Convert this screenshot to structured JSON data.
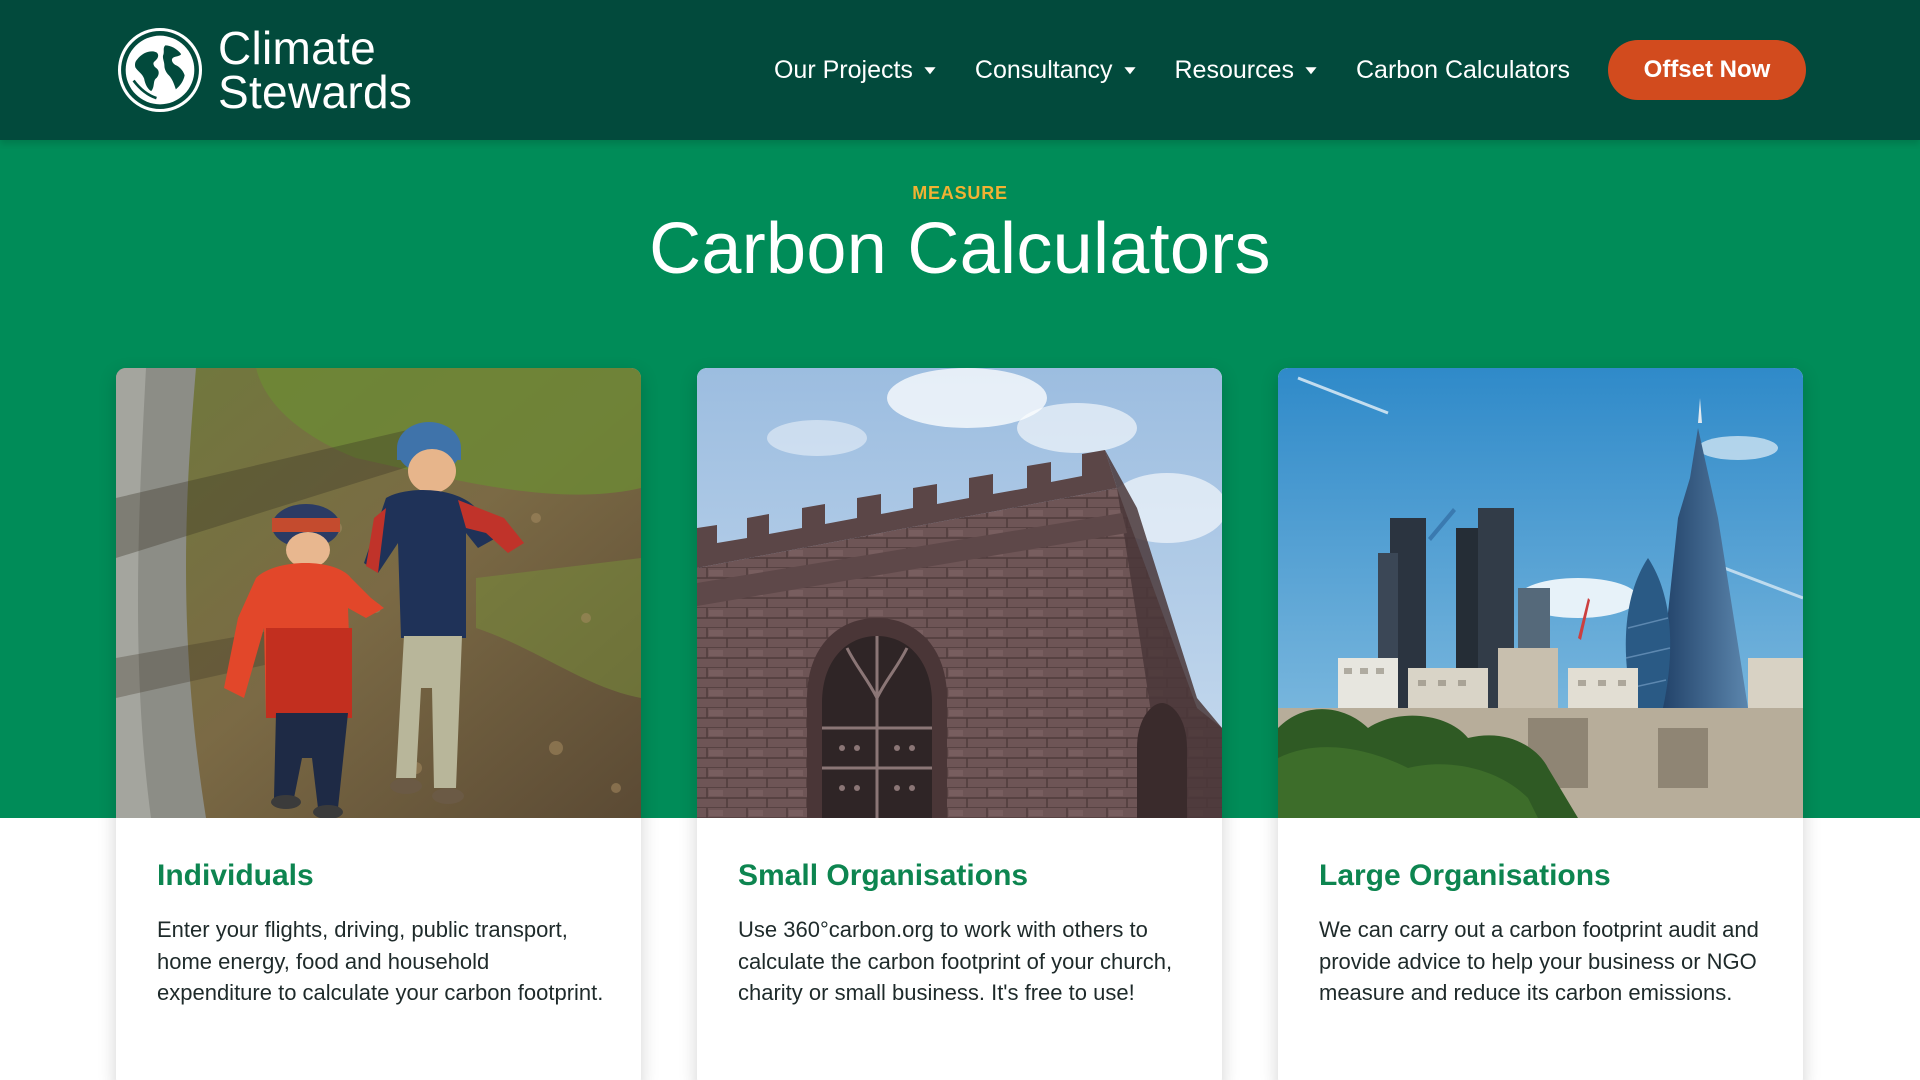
{
  "header": {
    "logo_line1": "Climate",
    "logo_line2": "Stewards",
    "nav": [
      {
        "label": "Our Projects",
        "has_dropdown": true
      },
      {
        "label": "Consultancy",
        "has_dropdown": true
      },
      {
        "label": "Resources",
        "has_dropdown": true
      },
      {
        "label": "Carbon Calculators",
        "has_dropdown": false
      }
    ],
    "cta_label": "Offset Now"
  },
  "hero": {
    "eyebrow": "MEASURE",
    "title": "Carbon Calculators"
  },
  "cards": [
    {
      "title": "Individuals",
      "text": "Enter your flights, driving, public transport, home energy, food and household expenditure to calculate your carbon footprint.",
      "image": "children-walking-in-park-photo"
    },
    {
      "title": "Small Organisations",
      "text": "Use 360°carbon.org to work with others to calculate the carbon footprint of your church, charity or small business. It's free to use!",
      "image": "stone-church-tower-photo"
    },
    {
      "title": "Large Organisations",
      "text": "We can carry out a carbon footprint audit and provide advice to help your business or NGO measure and reduce its carbon emissions.",
      "image": "london-city-skyline-photo"
    }
  ],
  "colors": {
    "header_bg": "#024a3c",
    "hero_bg": "#008c58",
    "eyebrow": "#f2b233",
    "cta_bg": "#d24b1e",
    "card_title": "#0d8550"
  }
}
